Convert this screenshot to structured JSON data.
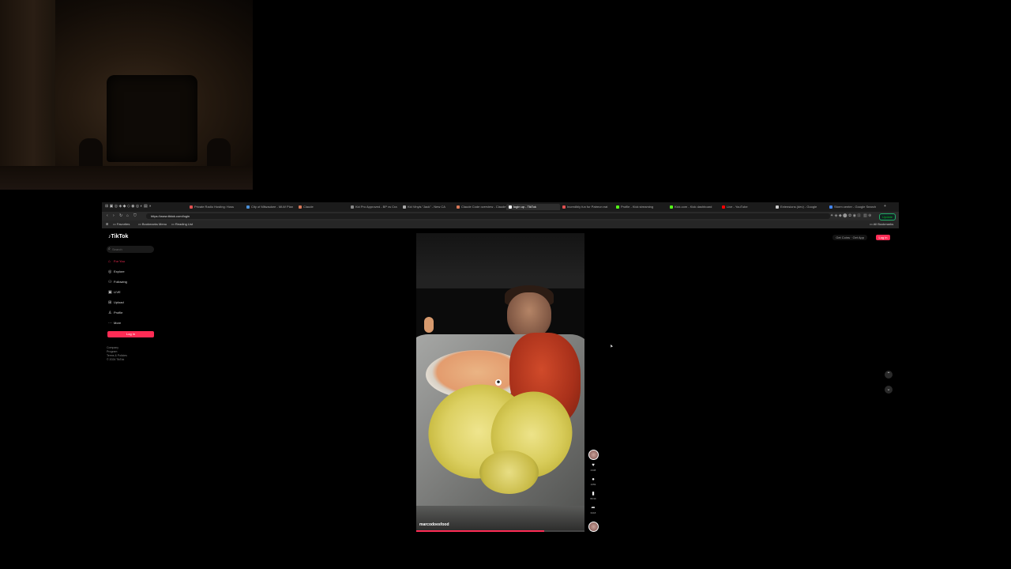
{
  "browser": {
    "tabs": [
      {
        "label": "Private Radio Hosting: Hoss",
        "active": false,
        "color": "#e05050"
      },
      {
        "label": "City of Milwaukee - MLW Plan",
        "active": false,
        "color": "#4a90d9"
      },
      {
        "label": "Claude",
        "active": false,
        "color": "#d97757"
      },
      {
        "label": "Kid Pro Approved - BP vs Cra",
        "active": false,
        "color": "#888888"
      },
      {
        "label": "Kid Vinyls \"Jack\" - New CA",
        "active": false,
        "color": "#aaaaaa"
      },
      {
        "label": "Claude Code overview - Claude",
        "active": false,
        "color": "#d97757"
      },
      {
        "label": "login up - TikTok",
        "active": true,
        "color": "#ffffff"
      },
      {
        "label": "Incredibly fun for Patreon eat",
        "active": false,
        "color": "#e05050"
      },
      {
        "label": "Profile - Kick streaming",
        "active": false,
        "color": "#53fc18"
      },
      {
        "label": "Kick.com - Kick dashboard",
        "active": false,
        "color": "#53fc18"
      },
      {
        "label": "Live - YouTube",
        "active": false,
        "color": "#ff0000"
      },
      {
        "label": "Extensions (dev) - Google",
        "active": false,
        "color": "#cccccc"
      },
      {
        "label": "Storm center - Google Search",
        "active": false,
        "color": "#4285f4"
      }
    ],
    "url": "https://www.tiktok.com/login",
    "update_label": "Update",
    "bookmarks": [
      "Favorites",
      "Bookmarks Menu",
      "Reading List"
    ],
    "all_bookmarks": "All Bookmarks"
  },
  "tiktok": {
    "logo": "TikTok",
    "search_placeholder": "Search",
    "nav": [
      {
        "label": "For You",
        "icon": "home-icon",
        "glyph": "⌂",
        "active": true
      },
      {
        "label": "Explore",
        "icon": "compass-icon",
        "glyph": "◎",
        "active": false
      },
      {
        "label": "Following",
        "icon": "following-icon",
        "glyph": "⚇",
        "active": false
      },
      {
        "label": "LIVE",
        "icon": "live-icon",
        "glyph": "▣",
        "active": false
      },
      {
        "label": "Upload",
        "icon": "upload-icon",
        "glyph": "⊞",
        "active": false
      },
      {
        "label": "Profile",
        "icon": "profile-icon",
        "glyph": "♙",
        "active": false
      },
      {
        "label": "More",
        "icon": "more-icon",
        "glyph": "⋯",
        "active": false
      }
    ],
    "login_label": "Log in",
    "footer": [
      "Company",
      "Program",
      "Terms & Policies",
      "© 2024 TikTok"
    ],
    "top_links": "Get Coins · Get App",
    "top_login": "Log in",
    "video": {
      "username": "marcodoesfood",
      "progress": 0.76
    },
    "actions": [
      {
        "icon": "heart-icon",
        "glyph": "♥",
        "count": "2338"
      },
      {
        "icon": "comment-icon",
        "glyph": "●",
        "count": "1059"
      },
      {
        "icon": "bookmark-icon",
        "glyph": "▮",
        "count": "98.9K"
      },
      {
        "icon": "share-icon",
        "glyph": "➦",
        "count": "6218"
      }
    ],
    "scroll_up": "⌃",
    "scroll_down": "⌄"
  },
  "colors": {
    "accent": "#fe2c55",
    "background": "#000000"
  }
}
